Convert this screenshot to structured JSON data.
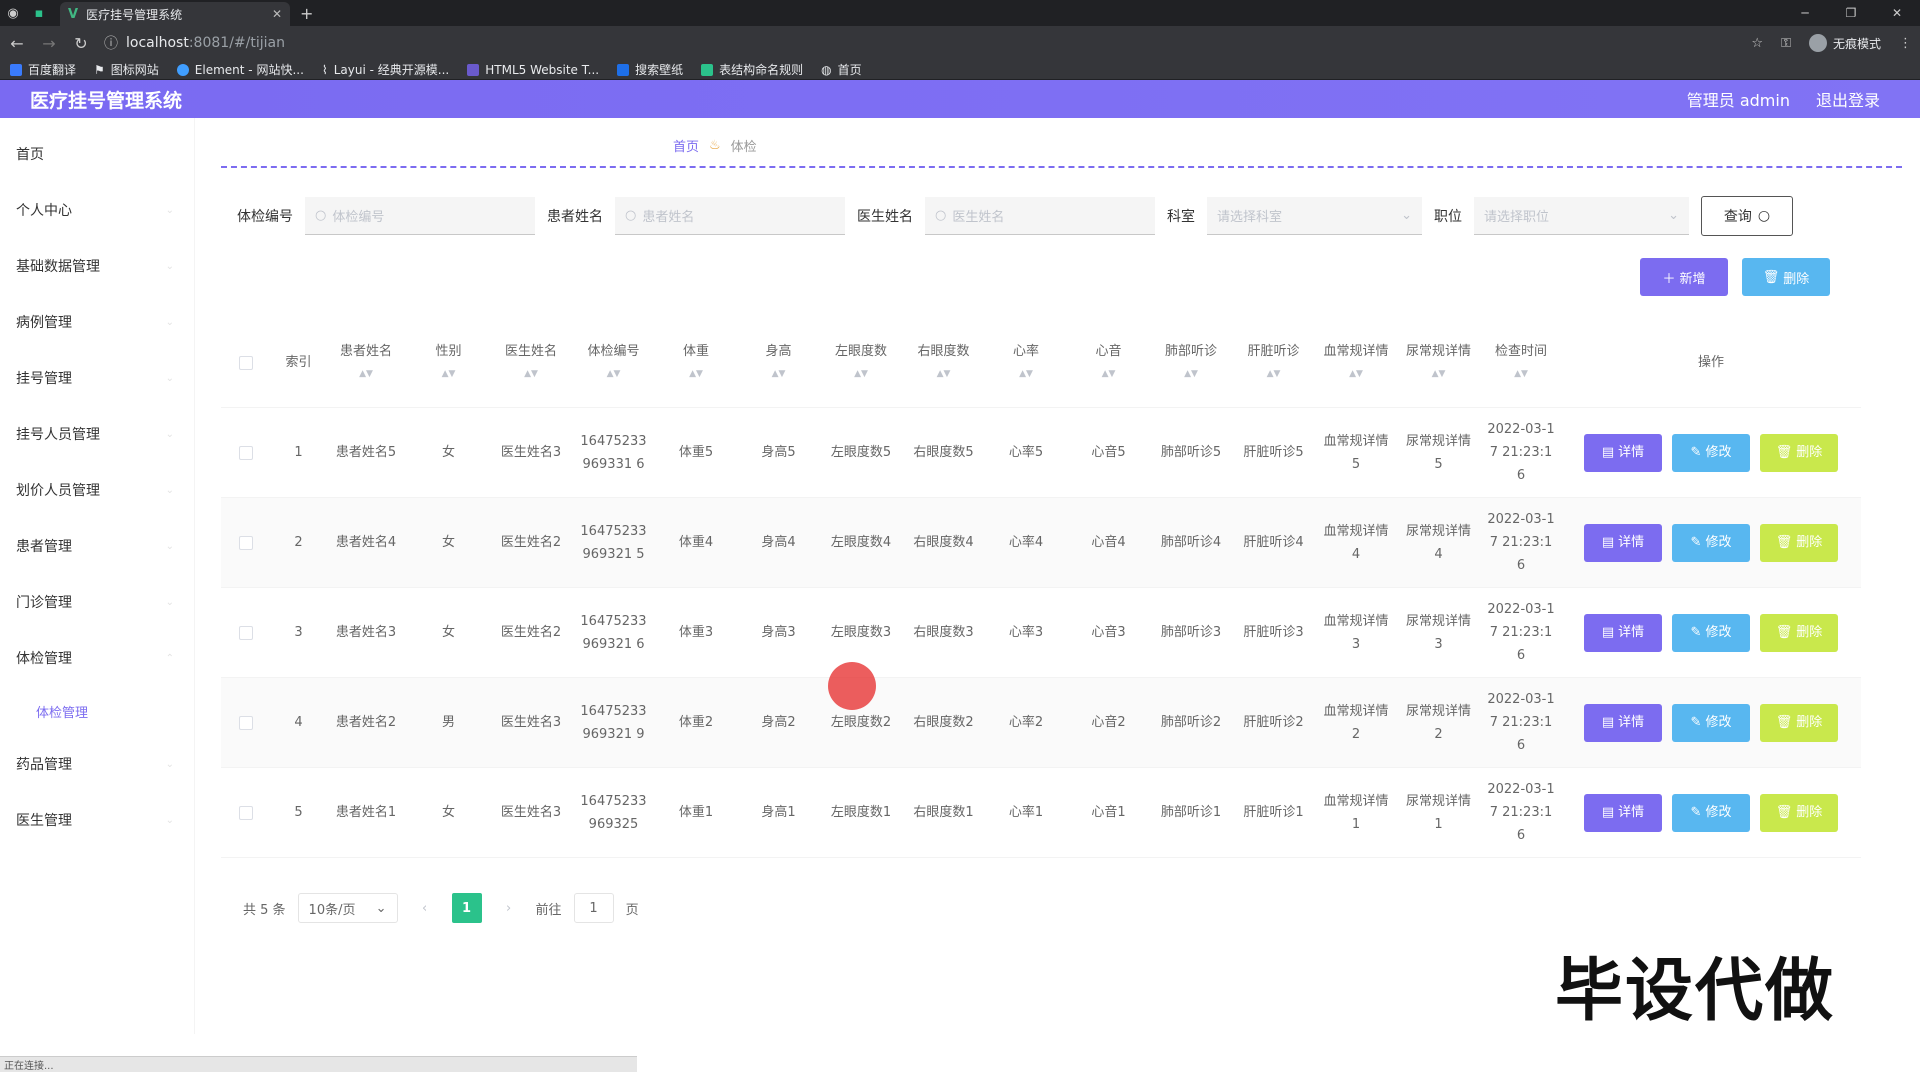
{
  "browser": {
    "tab_title": "医疗挂号管理系统",
    "url_host": "localhost",
    "url_path": ":8081/#/tijian",
    "incognito": "无痕模式",
    "bookmarks": [
      "百度翻译",
      "图标网站",
      "Element - 网站快...",
      "Layui - 经典开源模...",
      "HTML5 Website T...",
      "搜索壁纸",
      "表结构命名规则",
      "首页"
    ]
  },
  "header": {
    "title": "医疗挂号管理系统",
    "user": "管理员 admin",
    "logout": "退出登录"
  },
  "sidebar": {
    "items": [
      "首页",
      "个人中心",
      "基础数据管理",
      "病例管理",
      "挂号管理",
      "挂号人员管理",
      "划价人员管理",
      "患者管理",
      "门诊管理",
      "体检管理"
    ],
    "active_sub": "体检管理",
    "items_after": [
      "药品管理",
      "医生管理"
    ]
  },
  "breadcrumb": {
    "home": "首页",
    "current": "体检"
  },
  "search": {
    "f1_label": "体检编号",
    "f1_placeholder": "体检编号",
    "f2_label": "患者姓名",
    "f2_placeholder": "患者姓名",
    "f3_label": "医生姓名",
    "f3_placeholder": "医生姓名",
    "f4_label": "科室",
    "f4_placeholder": "请选择科室",
    "f5_label": "职位",
    "f5_placeholder": "请选择职位",
    "query": "查询"
  },
  "actions": {
    "add": "新增",
    "delete": "删除"
  },
  "table": {
    "headers": [
      "索引",
      "患者姓名",
      "性别",
      "医生姓名",
      "体检编号",
      "体重",
      "身高",
      "左眼度数",
      "右眼度数",
      "心率",
      "心音",
      "肺部听诊",
      "肝脏听诊",
      "血常规详情",
      "尿常规详情",
      "检查时间",
      "操作"
    ],
    "rows": [
      [
        "1",
        "患者姓名5",
        "女",
        "医生姓名3",
        "16475233969331 6",
        "体重5",
        "身高5",
        "左眼度数5",
        "右眼度数5",
        "心率5",
        "心音5",
        "肺部听诊5",
        "肝脏听诊5",
        "血常规详情5",
        "尿常规详情5",
        "2022-03-17 21:23:16"
      ],
      [
        "2",
        "患者姓名4",
        "女",
        "医生姓名2",
        "16475233969321 5",
        "体重4",
        "身高4",
        "左眼度数4",
        "右眼度数4",
        "心率4",
        "心音4",
        "肺部听诊4",
        "肝脏听诊4",
        "血常规详情4",
        "尿常规详情4",
        "2022-03-17 21:23:16"
      ],
      [
        "3",
        "患者姓名3",
        "女",
        "医生姓名2",
        "16475233969321 6",
        "体重3",
        "身高3",
        "左眼度数3",
        "右眼度数3",
        "心率3",
        "心音3",
        "肺部听诊3",
        "肝脏听诊3",
        "血常规详情3",
        "尿常规详情3",
        "2022-03-17 21:23:16"
      ],
      [
        "4",
        "患者姓名2",
        "男",
        "医生姓名3",
        "16475233969321 9",
        "体重2",
        "身高2",
        "左眼度数2",
        "右眼度数2",
        "心率2",
        "心音2",
        "肺部听诊2",
        "肝脏听诊2",
        "血常规详情2",
        "尿常规详情2",
        "2022-03-17 21:23:16"
      ],
      [
        "5",
        "患者姓名1",
        "女",
        "医生姓名3",
        "16475233969325",
        "体重1",
        "身高1",
        "左眼度数1",
        "右眼度数1",
        "心率1",
        "心音1",
        "肺部听诊1",
        "肝脏听诊1",
        "血常规详情1",
        "尿常规详情1",
        "2022-03-17 21:23:16"
      ]
    ],
    "op_detail": "详情",
    "op_edit": "修改",
    "op_delete": "删除"
  },
  "pager": {
    "total": "共 5 条",
    "size": "10条/页",
    "current": "1",
    "goto": "前往",
    "goto_val": "1",
    "page": "页"
  },
  "watermark": "毕设代做",
  "status": "正在连接...",
  "colors": {
    "primary": "#7c6cf0",
    "info": "#58b7f0",
    "warn": "#c9e84c",
    "active_page": "#2bc28b"
  }
}
